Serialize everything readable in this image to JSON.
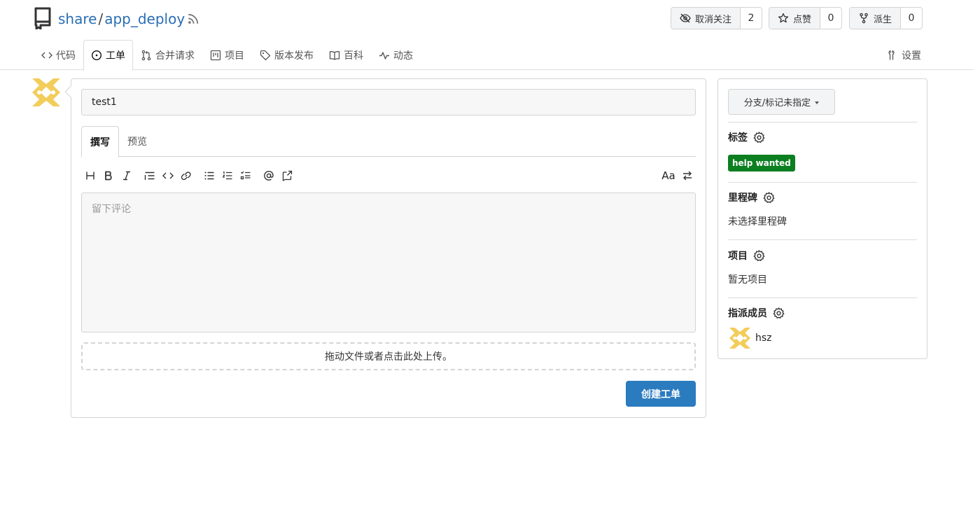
{
  "repo": {
    "owner": "share",
    "separator": "/",
    "name": "app_deploy"
  },
  "actions": {
    "watch": {
      "label": "取消关注",
      "count": "2"
    },
    "star": {
      "label": "点赞",
      "count": "0"
    },
    "fork": {
      "label": "派生",
      "count": "0"
    }
  },
  "tabs": [
    {
      "label": "代码",
      "icon": "code-icon"
    },
    {
      "label": "工单",
      "icon": "issue-icon",
      "active": true
    },
    {
      "label": "合并请求",
      "icon": "pull-request-icon"
    },
    {
      "label": "项目",
      "icon": "project-icon"
    },
    {
      "label": "版本发布",
      "icon": "tag-icon"
    },
    {
      "label": "百科",
      "icon": "book-icon"
    },
    {
      "label": "动态",
      "icon": "pulse-icon"
    }
  ],
  "settings_tab": {
    "label": "设置",
    "icon": "tools-icon"
  },
  "form": {
    "title_value": "test1",
    "editor_tabs": {
      "write": "撰写",
      "preview": "预览"
    },
    "comment_placeholder": "留下评论",
    "toolbar": {
      "font_toggle": "Aa"
    },
    "dropzone_text": "拖动文件或者点击此处上传。",
    "submit_label": "创建工单"
  },
  "sidebar": {
    "branch_label": "分支/标记未指定",
    "labels": {
      "heading": "标签",
      "items": [
        {
          "name": "help wanted",
          "color": "#0c7f21"
        }
      ]
    },
    "milestone": {
      "heading": "里程碑",
      "value": "未选择里程碑"
    },
    "projects": {
      "heading": "项目",
      "value": "暂无项目"
    },
    "assignees": {
      "heading": "指派成员",
      "items": [
        {
          "name": "hsz"
        }
      ]
    }
  },
  "colors": {
    "link": "#2a6eb3",
    "primary_button": "#2b7bbf",
    "avatar": "#f2cd5b"
  }
}
